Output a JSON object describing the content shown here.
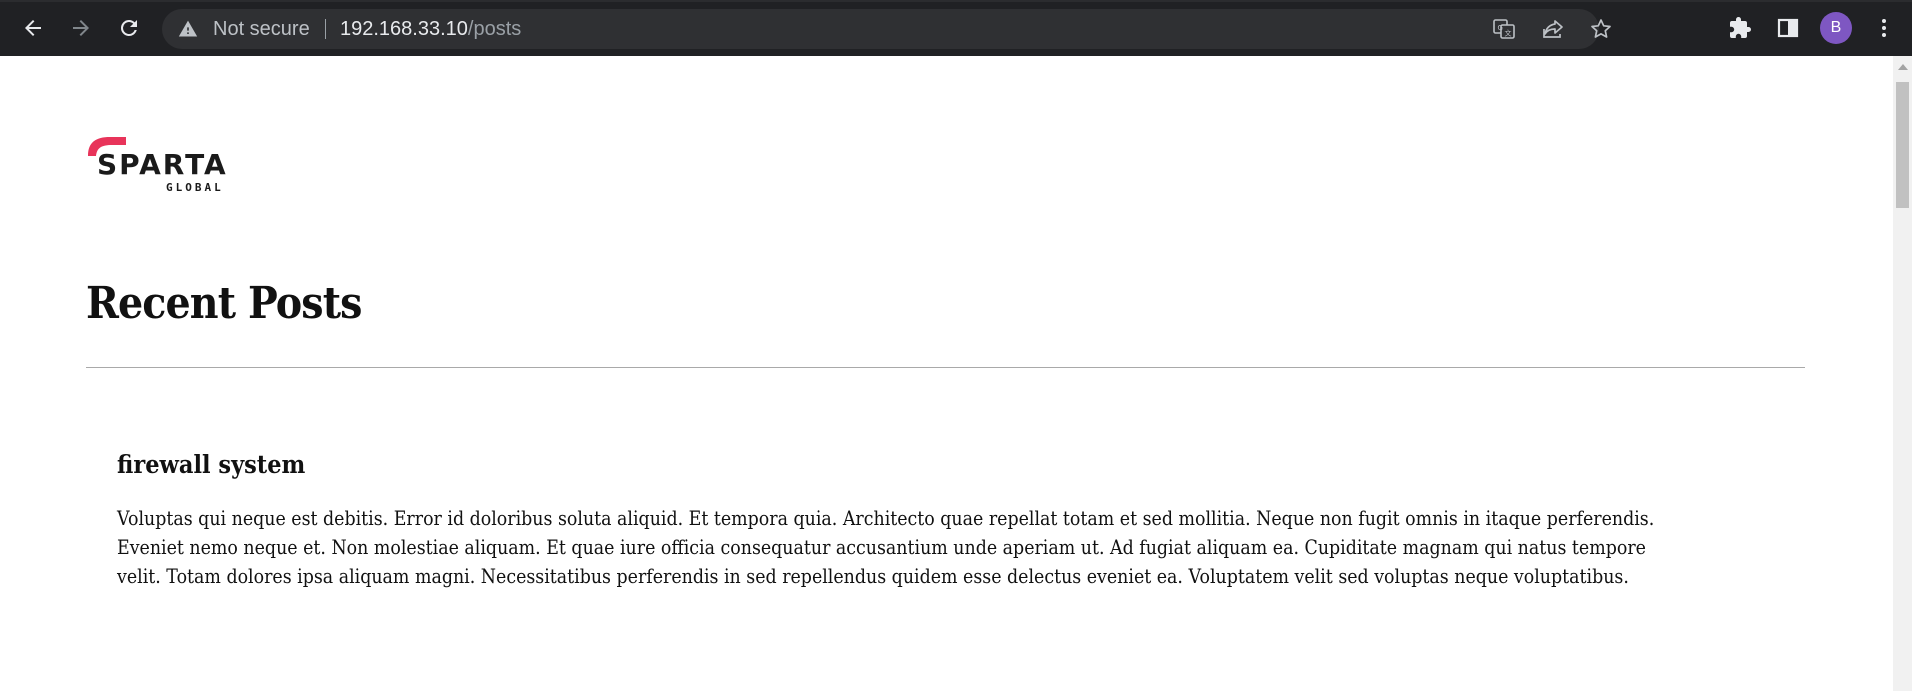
{
  "browser": {
    "back_icon": "arrow-left-icon",
    "forward_icon": "arrow-right-icon",
    "reload_icon": "reload-icon",
    "security_icon": "warning-triangle-icon",
    "security_label": "Not secure",
    "url_host": "192.168.33.10",
    "url_path": "/posts",
    "translate_icon": "translate-icon",
    "share_icon": "share-icon",
    "bookmark_icon": "star-icon",
    "extensions_icon": "puzzle-icon",
    "side_panel_icon": "side-panel-icon",
    "profile_initial": "B",
    "profile_color": "#7e57c2",
    "menu_icon": "kebab-menu-icon"
  },
  "site": {
    "logo_text": "SPARTA",
    "logo_subtext": "GLOBAL",
    "logo_accent_color": "#e8345a"
  },
  "main": {
    "heading": "Recent Posts",
    "posts": [
      {
        "title": "firewall system",
        "body": "Voluptas qui neque est debitis. Error id doloribus soluta aliquid. Et tempora quia. Architecto quae repellat totam et sed mollitia. Neque non fugit omnis in itaque perferendis. Eveniet nemo neque et. Non molestiae aliquam. Et quae iure officia consequatur accusantium unde aperiam ut. Ad fugiat aliquam ea. Cupiditate magnam qui natus tempore velit. Totam dolores ipsa aliquam magni. Necessitatibus perferendis in sed repellendus quidem esse delectus eveniet ea. Voluptatem velit sed voluptas neque voluptatibus."
      }
    ]
  }
}
